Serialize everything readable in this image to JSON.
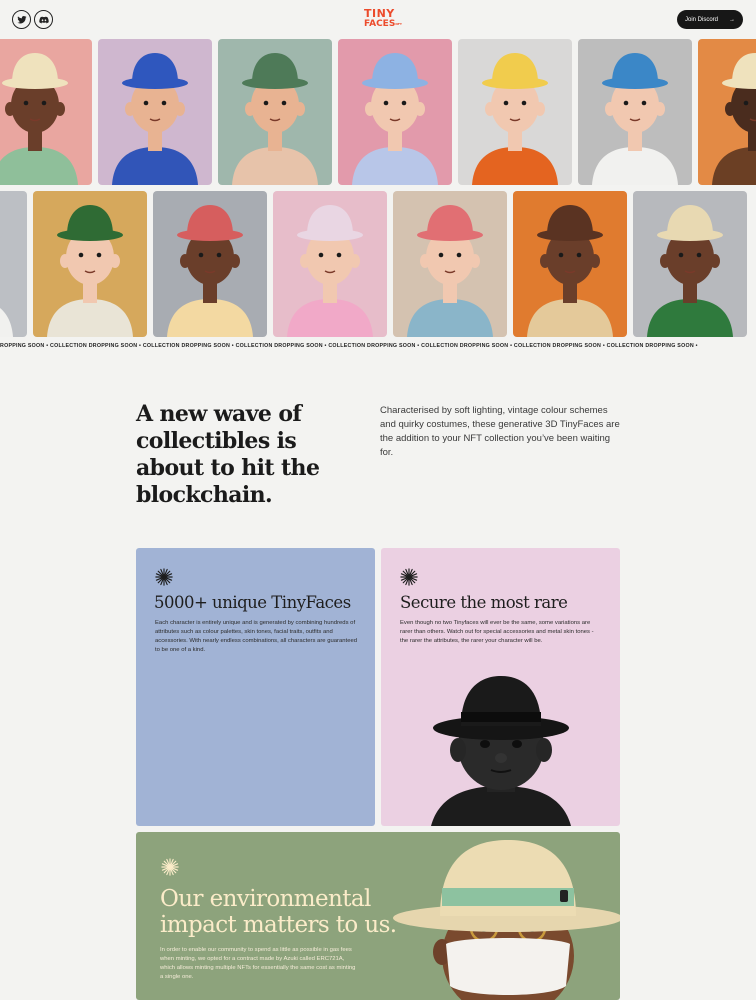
{
  "header": {
    "twitter_icon": "twitter-icon",
    "discord_icon": "discord-icon",
    "logo_line1": "TINY",
    "logo_line2": "FACES",
    "logo_tm": "NFT",
    "discord_button_label": "Join Discord",
    "discord_button_icon": "arrow-right-icon",
    "accent_color": "#ec4b2c"
  },
  "strips": {
    "row1": [
      {
        "name": "chef",
        "bg": "#e9a6a0",
        "skin": "#6a3e2a",
        "outfit": "#8fbf9a",
        "hat": "#efe2bd"
      },
      {
        "name": "blue-hat-mask",
        "bg": "#cfb7cf",
        "skin": "#e8b392",
        "outfit": "#3155b8",
        "hat": "#2f57be"
      },
      {
        "name": "green-hat",
        "bg": "#9fb7ac",
        "skin": "#e8b392",
        "outfit": "#e7c3aa",
        "hat": "#4e7a58"
      },
      {
        "name": "clown",
        "bg": "#e29aab",
        "skin": "#f1c8b0",
        "outfit": "#b8c6e8",
        "hat": "#8db2e3"
      },
      {
        "name": "bear-hat",
        "bg": "#d9d8d7",
        "skin": "#f1c8b0",
        "outfit": "#e46420",
        "hat": "#f1cc4d"
      },
      {
        "name": "cap",
        "bg": "#bdbdbd",
        "skin": "#f1c8b0",
        "outfit": "#f1f1ef",
        "hat": "#3b87c7"
      },
      {
        "name": "cowboy",
        "bg": "#e38a45",
        "skin": "#4a2c1e",
        "outfit": "#6b3f24",
        "hat": "#efe2bd"
      }
    ],
    "row2": [
      {
        "name": "partial",
        "bg": "#bcbfc4",
        "skin": "#f1c8b0",
        "outfit": "#f1f1ef",
        "hat": "#bcbfc4"
      },
      {
        "name": "beret",
        "bg": "#d6a85c",
        "skin": "#f1c8b0",
        "outfit": "#e9e4d6",
        "hat": "#2f6b34"
      },
      {
        "name": "pink-hat",
        "bg": "#a8acb2",
        "skin": "#6a3e2a",
        "outfit": "#f3d9a2",
        "hat": "#d65e5e"
      },
      {
        "name": "sailor",
        "bg": "#e7bdca",
        "skin": "#f1c8b0",
        "outfit": "#f1a9c8",
        "hat": "#e9d6e3"
      },
      {
        "name": "beanie",
        "bg": "#d4c2b0",
        "skin": "#f1c8b0",
        "outfit": "#8ab5c9",
        "hat": "#e16f73"
      },
      {
        "name": "apron",
        "bg": "#e07b2f",
        "skin": "#6a3e2a",
        "outfit": "#e4c99a",
        "hat": "#5a3322"
      },
      {
        "name": "straw-hat",
        "bg": "#b7b9bd",
        "skin": "#6a3e2a",
        "outfit": "#2f7a3d",
        "hat": "#e8d9b2"
      }
    ]
  },
  "ticker": {
    "text": "ROPPING SOON • COLLECTION DROPPING SOON • COLLECTION DROPPING SOON • COLLECTION DROPPING SOON • COLLECTION DROPPING SOON • COLLECTION DROPPING SOON • COLLECTION DROPPING SOON • COLLECTION DROPPING SOON •"
  },
  "intro": {
    "title": "A new wave of collectibles is about to hit the blockchain.",
    "text": "Characterised by soft lighting, vintage colour schemes and quirky costumes, these generative 3D TinyFaces are the addition to your NFT collection you’ve been waiting for."
  },
  "features": {
    "unique": {
      "icon": "burst-icon",
      "title": "5000+ unique TinyFaces",
      "body": "Each character is entirely unique and is generated by combining hundreds of attributes such as colour palettes, skin tones, facial traits, outfits and accessories. With nearly endless combinations, all characters are guaranteed to be one of a kind.",
      "bg": "#a1b3d5"
    },
    "rare": {
      "icon": "burst-icon",
      "title": "Secure the most rare",
      "body": "Even though no two Tinyfaces will ever be the same, some variations are rarer than others. Watch out for special accessories and metal skin tones - the rarer the attributes, the rarer your character will be.",
      "bg": "#ebd0e2"
    },
    "environment": {
      "icon": "burst-icon",
      "title": "Our environmental impact matters to us.",
      "body": "In order to enable our community to spend as little as possible in gas fees when minting, we opted for a contract made by Azuki called ERC721A, which allows minting multiple NFTs for essentially the same cost as minting a single one.",
      "bg": "#8da37c"
    }
  }
}
